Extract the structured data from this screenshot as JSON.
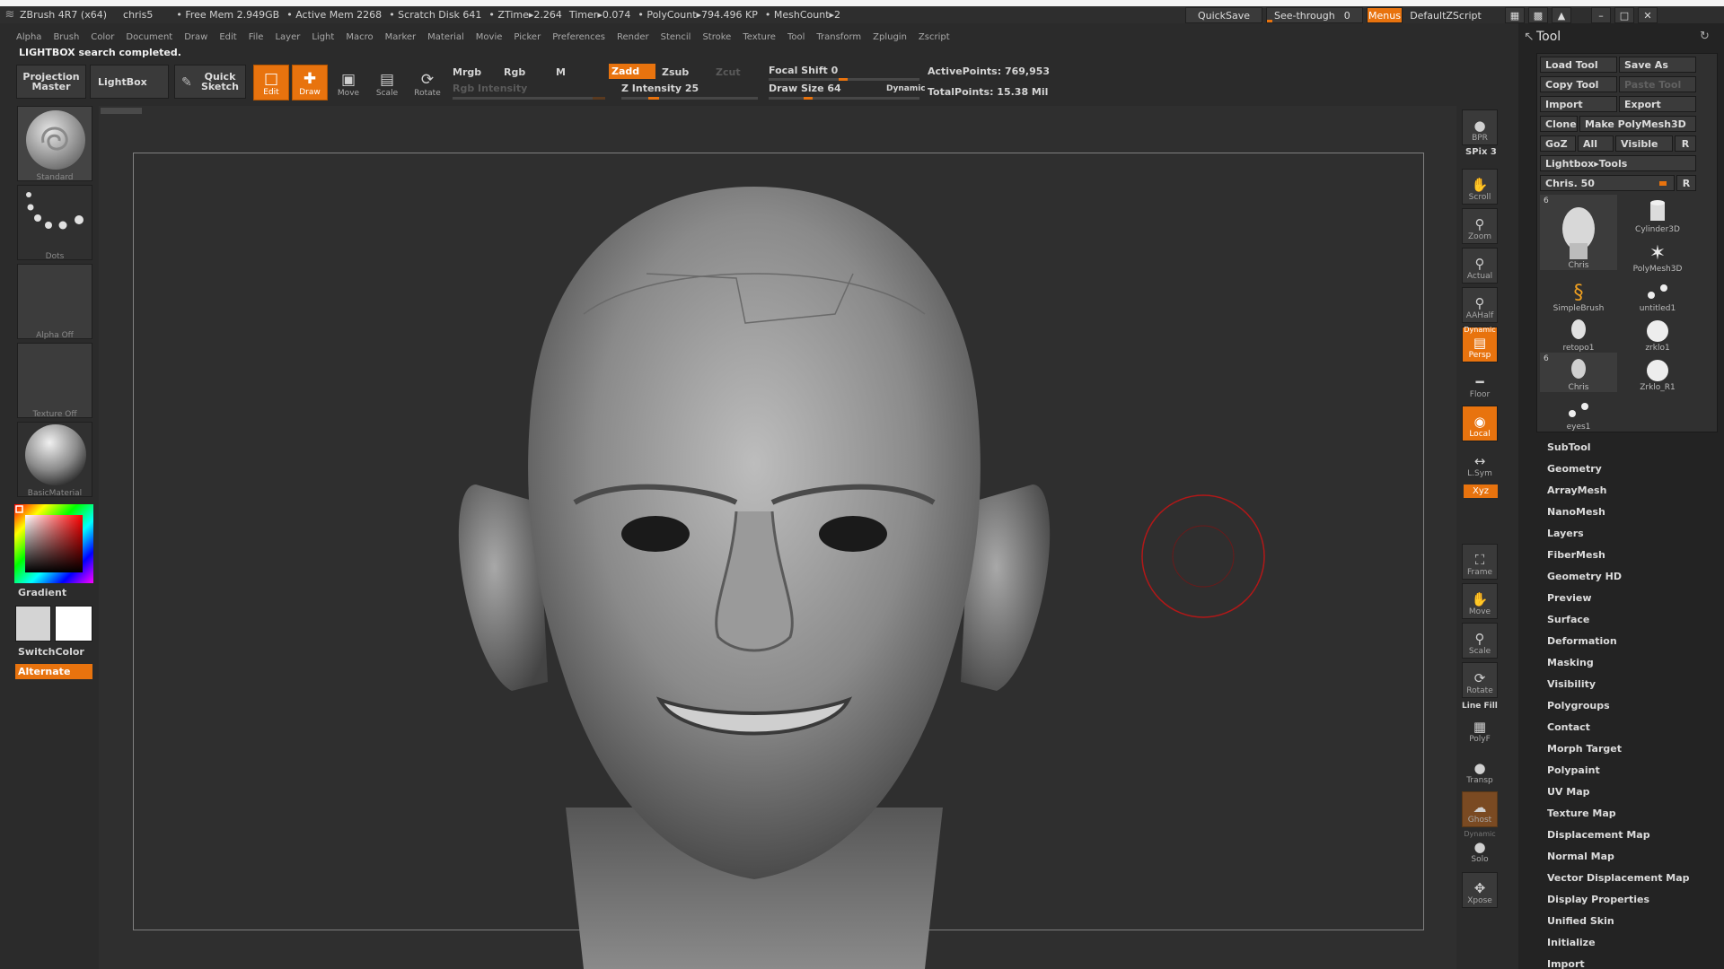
{
  "titlebar": {
    "app_title": "ZBrush 4R7 (x64)",
    "user": "chris5",
    "stats": [
      "• Free Mem 2.949GB",
      "• Active Mem 2268",
      "• Scratch Disk 641",
      "• ZTime▸2.264",
      "Timer▸0.074",
      "• PolyCount▸794.496 KP",
      "• MeshCount▸2"
    ],
    "quicksave": "QuickSave",
    "see_through_label": "See-through",
    "see_through_value": "0",
    "menus_label": "Menus",
    "script_label": "DefaultZScript",
    "seethrough_level": 0.0
  },
  "menubar": {
    "items": [
      "Alpha",
      "Brush",
      "Color",
      "Document",
      "Draw",
      "Edit",
      "File",
      "Layer",
      "Light",
      "Macro",
      "Marker",
      "Material",
      "Movie",
      "Picker",
      "Preferences",
      "Render",
      "Stencil",
      "Stroke",
      "Texture",
      "Tool",
      "Transform",
      "Zplugin",
      "Zscript"
    ]
  },
  "status_message": "LIGHTBOX search completed.",
  "toolbar": {
    "projection_master": "Projection Master",
    "lightbox": "LightBox",
    "quick_sketch": "Quick Sketch",
    "edit": "Edit",
    "draw": "Draw",
    "move": "Move",
    "scale": "Scale",
    "rotate": "Rotate",
    "mrgb": "Mrgb",
    "rgb": "Rgb",
    "m": "M",
    "rgb_intensity": "Rgb Intensity",
    "zadd": "Zadd",
    "zsub": "Zsub",
    "zcut": "Zcut",
    "z_intensity": "Z Intensity 25",
    "z_intensity_value": 25,
    "focal_shift": "Focal Shift 0",
    "focal_shift_value": 0,
    "draw_size": "Draw Size 64",
    "draw_size_value": 64,
    "dynamic": "Dynamic",
    "active_points": "ActivePoints: 769,953",
    "total_points": "TotalPoints: 15.38 Mil"
  },
  "left_shelf": {
    "brush": "Standard",
    "stroke": "Dots",
    "alpha": "Alpha Off",
    "texture": "Texture Off",
    "material": "BasicMaterial",
    "gradient": "Gradient",
    "switch_color": "SwitchColor",
    "alternate": "Alternate",
    "main_color": "#d4d4d4",
    "secondary_color": "#ffffff"
  },
  "right_shelf": {
    "bpr": "BPR",
    "spix": "SPix 3",
    "scroll": "Scroll",
    "zoom": "Zoom",
    "actual": "Actual",
    "aahalf": "AAHalf",
    "dynamic": "Dynamic",
    "persp": "Persp",
    "floor": "Floor",
    "local": "Local",
    "lsym": "L.Sym",
    "xyz": "Xyz",
    "frame": "Frame",
    "move": "Move",
    "scale": "Scale",
    "rotate": "Rotate",
    "line_fill": "Line Fill",
    "polyf": "PolyF",
    "transp": "Transp",
    "ghost": "Ghost",
    "solo_dynamic": "Dynamic",
    "solo": "Solo",
    "xpose": "Xpose"
  },
  "tool_palette": {
    "title": "Tool",
    "load_tool": "Load Tool",
    "save_as": "Save As",
    "copy_tool": "Copy Tool",
    "paste_tool": "Paste Tool",
    "import": "Import",
    "export": "Export",
    "clone": "Clone",
    "make_polymesh": "Make PolyMesh3D",
    "goz": "GoZ",
    "all": "All",
    "visible": "Visible",
    "r": "R",
    "lightbox_tools": "Lightbox▸Tools",
    "current_tool": "Chris. 50",
    "thumbs": [
      {
        "label": "Chris",
        "num": "6"
      },
      {
        "label": "Cylinder3D",
        "num": ""
      },
      {
        "label": "PolyMesh3D",
        "num": ""
      },
      {
        "label": "SimpleBrush",
        "num": ""
      },
      {
        "label": "untitled1",
        "num": ""
      },
      {
        "label": "retopo1",
        "num": ""
      },
      {
        "label": "zrklo1",
        "num": ""
      },
      {
        "label": "Chris",
        "num": "6"
      },
      {
        "label": "Zrklo_R1",
        "num": ""
      },
      {
        "label": "eyes1",
        "num": ""
      }
    ],
    "sections": [
      "SubTool",
      "Geometry",
      "ArrayMesh",
      "NanoMesh",
      "Layers",
      "FiberMesh",
      "Geometry HD",
      "Preview",
      "Surface",
      "Deformation",
      "Masking",
      "Visibility",
      "Polygroups",
      "Contact",
      "Morph Target",
      "Polypaint",
      "UV Map",
      "Texture Map",
      "Displacement Map",
      "Normal Map",
      "Vector Displacement Map",
      "Display Properties",
      "Unified Skin",
      "Initialize",
      "Import"
    ]
  },
  "icons": {
    "zbrush_logo": "zbrush-logo-icon",
    "brush": "sphere-brush-icon",
    "stroke": "dots-stroke-icon",
    "material": "material-sphere-icon",
    "color": "color-picker-icon",
    "brush_cursor": "draw-circle-icon"
  },
  "colors": {
    "accent": "#e8730e",
    "background": "#2b2b2b",
    "canvas": "#2f2f2f",
    "tray": "#232323"
  }
}
